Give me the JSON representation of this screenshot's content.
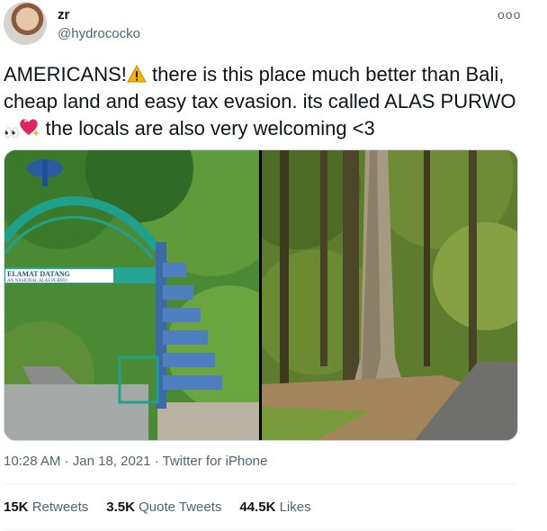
{
  "user": {
    "display_name": "zr",
    "handle": "@hydrocockо"
  },
  "more_label": "ooo",
  "tweet": {
    "text_part1": "AMERICANS!",
    "text_part2": " there is this place much better than Bali, cheap land and easy tax evasion. its called ALAS PURWO ",
    "text_part3": " the locals are also very welcoming <3",
    "emoji_warning": "⚠",
    "emoji_eyes": "👀",
    "emoji_heart": "💖"
  },
  "photo_left": {
    "sign_line1": "ELAMAT DATANG",
    "sign_line2": "AN NASIONAL ALAS PURWO"
  },
  "meta": {
    "time": "10:28 AM",
    "date": "Jan 18, 2021",
    "source": "Twitter for iPhone"
  },
  "stats": {
    "retweets_count": "15K",
    "retweets_label": "Retweets",
    "quotes_count": "3.5K",
    "quotes_label": "Quote Tweets",
    "likes_count": "44.5K",
    "likes_label": "Likes"
  },
  "colors": {
    "text": "#0f1419",
    "secondary": "#536471",
    "border": "#cfd9de",
    "warning": "#f4b400",
    "heart": "#e0245e"
  }
}
